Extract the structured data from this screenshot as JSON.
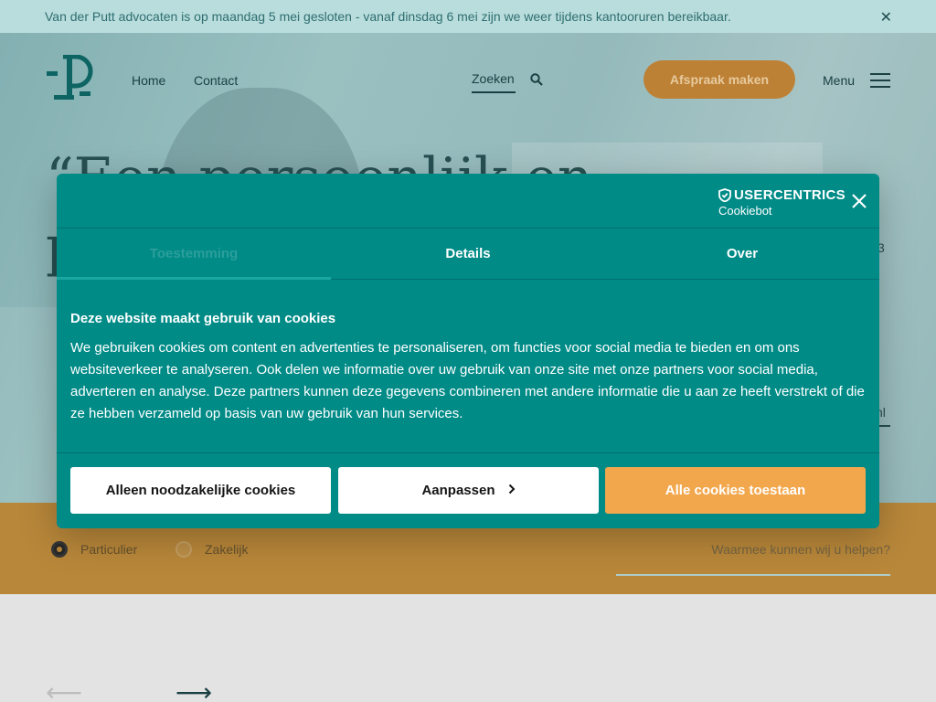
{
  "announcement": {
    "text": "Van der Putt advocaten is op maandag 5 mei gesloten - vanaf dinsdag 6 mei zijn we weer tijdens kantooruren bereikbaar.",
    "close_icon": "close-icon"
  },
  "nav": {
    "home": "Home",
    "contact": "Contact",
    "search_label": "Zoeken",
    "cta": "Afspraak maken",
    "menu": "Menu"
  },
  "hero": {
    "quote_line1": "“Een persoonlijk en",
    "quote_line2": "p",
    "side_num": "3",
    "side_link": "nl"
  },
  "search_band": {
    "option1": "Particulier",
    "option2": "Zakelijk",
    "placeholder": "Waarmee kunnen wij u helpen?"
  },
  "cookie_dialog": {
    "brand_main": "USERCENTRICS",
    "brand_sub": "Cookiebot",
    "tabs": [
      "Toestemming",
      "Details",
      "Over"
    ],
    "title": "Deze website maakt gebruik van cookies",
    "body": "We gebruiken cookies om content en advertenties te personaliseren, om functies voor social media te bieden en om ons websiteverkeer te analyseren. Ook delen we informatie over uw gebruik van onze site met onze partners voor social media, adverteren en analyse. Deze partners kunnen deze gegevens combineren met andere informatie die u aan ze heeft verstrekt of die ze hebben verzameld op basis van uw gebruik van hun services.",
    "btn_necessary": "Alleen noodzakelijke cookies",
    "btn_customize": "Aanpassen",
    "btn_allow_all": "Alle cookies toestaan"
  },
  "colors": {
    "dialog": "#008b87",
    "accent_orange": "#f3a74d",
    "band": "#c4903e"
  }
}
